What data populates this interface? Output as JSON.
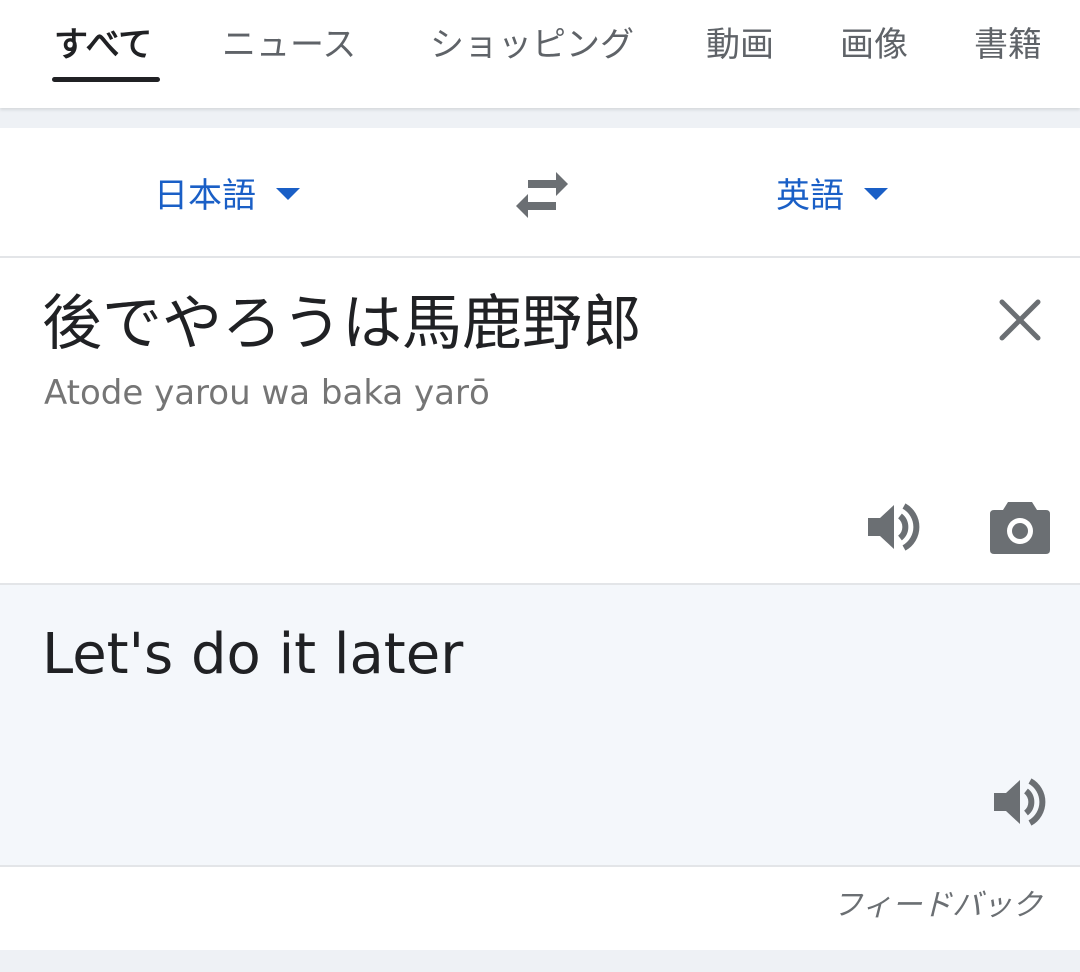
{
  "tabs": [
    {
      "label": "すべて",
      "active": true
    },
    {
      "label": "ニュース",
      "active": false
    },
    {
      "label": "ショッピング",
      "active": false
    },
    {
      "label": "動画",
      "active": false
    },
    {
      "label": "画像",
      "active": false
    },
    {
      "label": "書籍",
      "active": false
    }
  ],
  "translator": {
    "source_language": "日本語",
    "target_language": "英語",
    "source_text": "後でやろうは馬鹿野郎",
    "romanization": "Atode yarou wa baka yarō",
    "translation": "Let's do it later",
    "feedback_label": "フィードバック",
    "icons": {
      "swap": "swap-arrows-icon",
      "clear": "close-icon",
      "source_audio": "speaker-icon",
      "camera": "camera-icon",
      "target_audio": "speaker-icon",
      "dropdown": "caret-down-icon"
    }
  },
  "colors": {
    "accent": "#1a5fc6",
    "text_primary": "#202124",
    "text_secondary": "#757575",
    "icon_gray": "#6b6f73",
    "translation_bg": "#f4f7fb",
    "page_bg": "#eef1f5"
  }
}
